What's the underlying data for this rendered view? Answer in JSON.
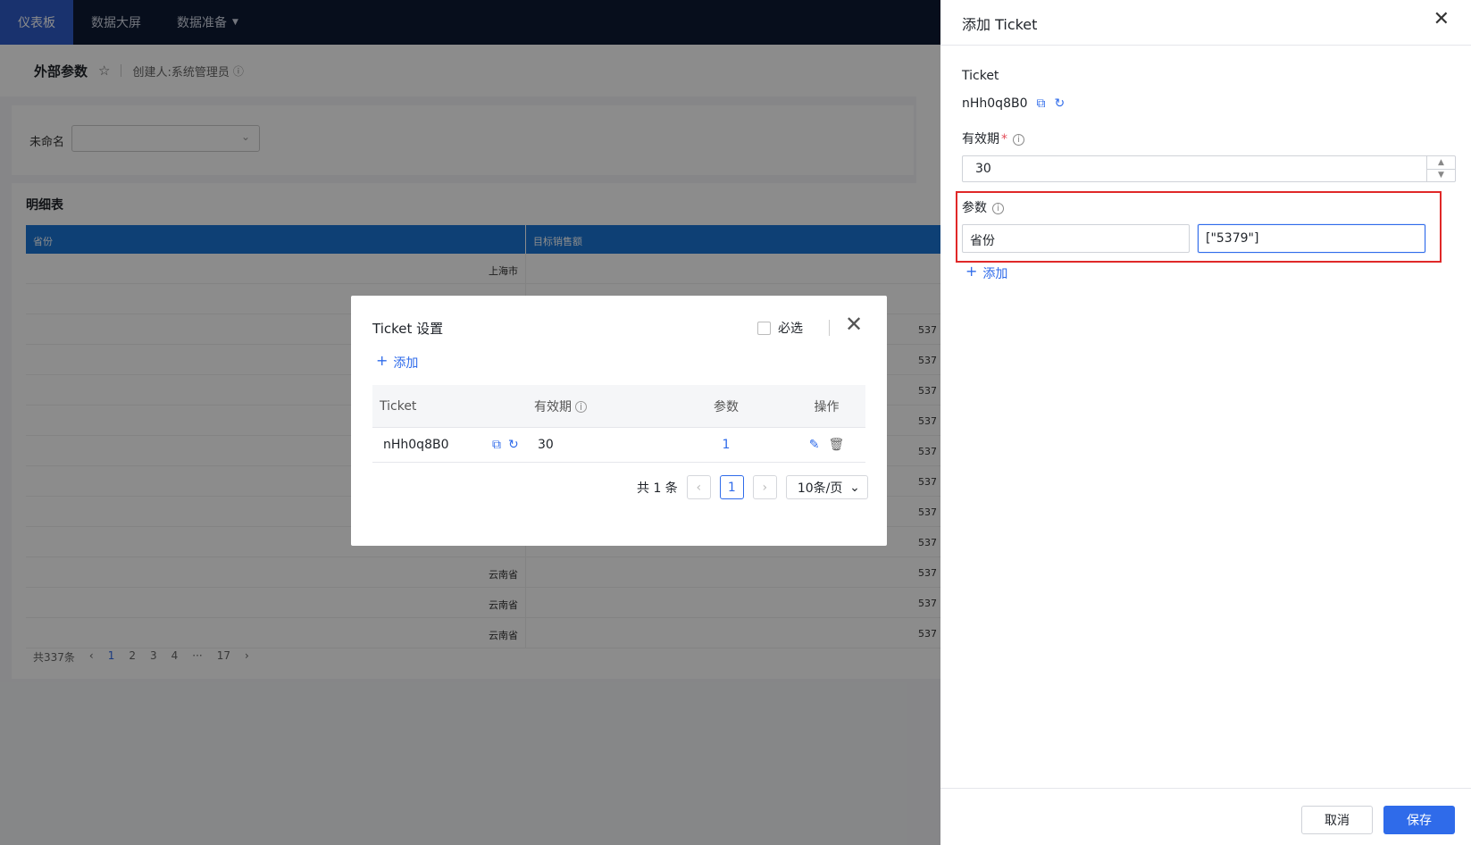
{
  "topbar": {
    "items": [
      {
        "label": "仪表板",
        "active": true
      },
      {
        "label": "数据大屏",
        "active": false
      },
      {
        "label": "数据准备",
        "active": false,
        "caret": "▼"
      }
    ]
  },
  "subheader": {
    "title": "外部参数",
    "star": "☆",
    "creator": "创建人:系统管理员",
    "info": "ⓘ"
  },
  "filter": {
    "label": "未命名"
  },
  "detail_table": {
    "title": "明细表",
    "columns": [
      "省份",
      "目标销售额"
    ],
    "rows": [
      {
        "province": "上海市",
        "value": ""
      },
      {
        "province": "",
        "value": ""
      },
      {
        "province": "",
        "value": "537"
      },
      {
        "province": "",
        "value": "537"
      },
      {
        "province": "",
        "value": "537"
      },
      {
        "province": "",
        "value": "537"
      },
      {
        "province": "",
        "value": "537"
      },
      {
        "province": "",
        "value": "537"
      },
      {
        "province": "",
        "value": "537"
      },
      {
        "province": "",
        "value": "537"
      },
      {
        "province": "云南省",
        "value": "537"
      },
      {
        "province": "云南省",
        "value": "537"
      },
      {
        "province": "云南省",
        "value": "537"
      }
    ],
    "pager": {
      "total": "共337条",
      "pages": [
        "1",
        "2",
        "3",
        "4",
        "···",
        "17"
      ],
      "prev": "‹",
      "next": "›"
    }
  },
  "ticket_modal": {
    "title": "Ticket 设置",
    "required_label": "必选",
    "close": "✕",
    "add_label": "添加",
    "columns": {
      "ticket": "Ticket",
      "valid": "有效期",
      "param": "参数",
      "op": "操作"
    },
    "row": {
      "ticket": "nHh0q8B0",
      "valid": "30",
      "param": "1"
    },
    "pager": {
      "total": "共 1 条",
      "current": "1",
      "size": "10条/页",
      "prev": "‹",
      "next": "›",
      "chevron": "⌄"
    }
  },
  "drawer": {
    "title": "添加 Ticket",
    "close": "✕",
    "ticket_label": "Ticket",
    "ticket_value": "nHh0q8B0",
    "valid_label": "有效期",
    "required_mark": "*",
    "valid_value": "30",
    "param_label": "参数",
    "param_key": "省份",
    "param_value": "[\"5379\"]",
    "add_label": "添加",
    "cancel_label": "取消",
    "save_label": "保存"
  },
  "colors": {
    "accent": "#2f6bea",
    "topbar": "#0e1a33",
    "highlight": "#e02828",
    "header_blue": "#1a75d6"
  }
}
